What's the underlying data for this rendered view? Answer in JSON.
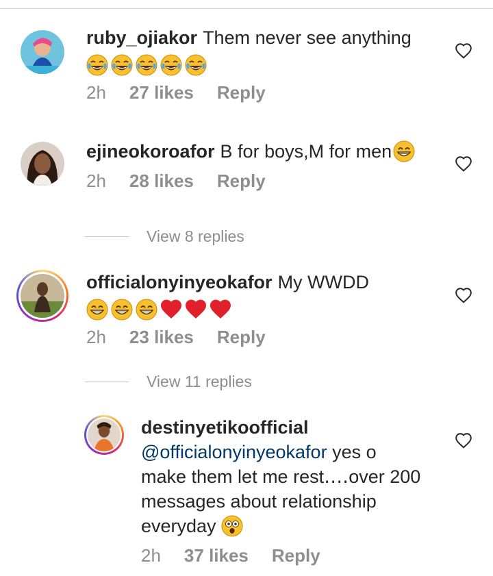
{
  "comments": [
    {
      "username": "ruby_ojiakor",
      "text": "Them never see anything",
      "emojis": [
        "tears-of-joy",
        "tears-of-joy",
        "tears-of-joy",
        "tears-of-joy",
        "tears-of-joy"
      ],
      "time": "2h",
      "likes": "27 likes",
      "reply": "Reply"
    },
    {
      "username": "ejineokoroafor",
      "text": "B for boys,M for men",
      "emojis": [
        "grin"
      ],
      "time": "2h",
      "likes": "28 likes",
      "reply": "Reply"
    },
    {
      "username": "officialonyinyeokafor",
      "text": "My WWDD",
      "emojis": [
        "grin",
        "grin",
        "grin",
        "red-heart",
        "red-heart",
        "red-heart"
      ],
      "time": "2h",
      "likes": "23 likes",
      "reply": "Reply"
    }
  ],
  "view_replies_1": "View 8 replies",
  "view_replies_2": "View 11 replies",
  "reply_comment": {
    "username": "destinyetikoofficial",
    "mention": "@officialonyinyeokafor",
    "text_line1": " yes o",
    "text_line2": "make them let me rest․․․․over 200",
    "text_line3": "messages about relationship",
    "text_line4": "everyday",
    "emoji": "astonished",
    "time": "2h",
    "likes": "37 likes",
    "reply": "Reply"
  },
  "colors": {
    "text": "#262626",
    "secondary": "#8e8e8e",
    "mention": "#00376b",
    "divider": "#dbdbdb"
  }
}
